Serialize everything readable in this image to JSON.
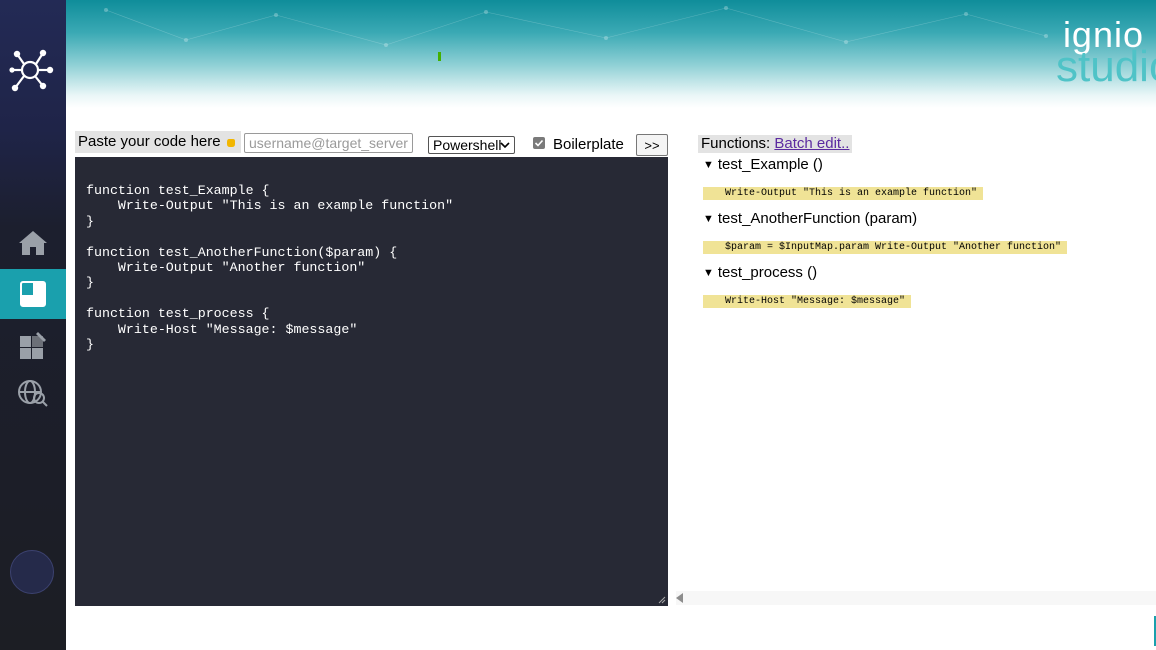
{
  "brand": {
    "line1": "ignio",
    "line2": "studio"
  },
  "sidebar": {
    "items": [
      {
        "name": "home",
        "icon": "home-icon",
        "active": false
      },
      {
        "name": "workspace",
        "icon": "workspace-icon",
        "active": true
      },
      {
        "name": "widgets",
        "icon": "widgets-icon",
        "active": false
      },
      {
        "name": "web-search",
        "icon": "globe-search-icon",
        "active": false
      }
    ],
    "active_color": "#1aa0ad"
  },
  "toolbar": {
    "paste_label": "Paste your code here",
    "target_placeholder": "username@target_server",
    "language_selected": "Powershell",
    "boilerplate_label": "Boilerplate",
    "boilerplate_checked": true,
    "go_label": ">>"
  },
  "editor": {
    "code": "function test_Example {\n    Write-Output \"This is an example function\"\n}\n\nfunction test_AnotherFunction($param) {\n    Write-Output \"Another function\"\n}\n\nfunction test_process {\n    Write-Host \"Message: $message\"\n}"
  },
  "functions_panel": {
    "label": "Functions:",
    "batch_edit": "Batch edit..",
    "functions": [
      {
        "title": "test_Example ()",
        "body": "Write-Output \"This is an example function\""
      },
      {
        "title": "test_AnotherFunction (param)",
        "body": "$param = $InputMap.param Write-Output \"Another function\""
      },
      {
        "title": "test_process ()",
        "body": "Write-Host \"Message: $message\""
      }
    ]
  },
  "colors": {
    "editor_bg": "#272935",
    "highlight": "#f0e396",
    "accent": "#1aa0ad"
  }
}
